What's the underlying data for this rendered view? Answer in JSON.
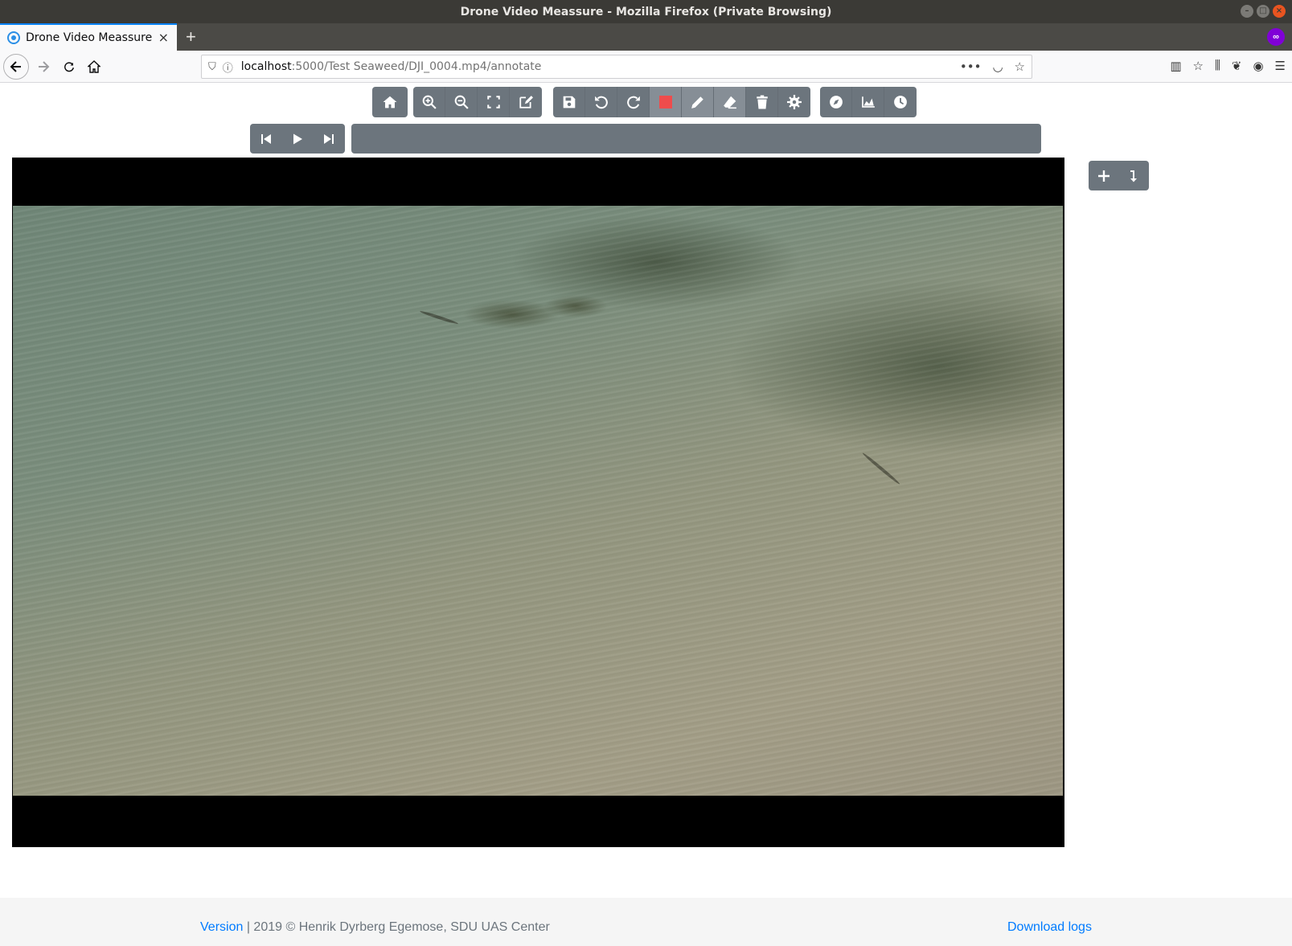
{
  "window": {
    "title": "Drone Video Meassure - Mozilla Firefox (Private Browsing)",
    "controls": [
      "minimize",
      "maximize",
      "close"
    ]
  },
  "browser": {
    "tab_title": "Drone Video Meassure",
    "url_host": "localhost",
    "url_path": ":5000/Test Seaweed/DJI_0004.mp4/annotate"
  },
  "toolbar": {
    "groups": [
      [
        "home-icon"
      ],
      [
        "zoom-in-icon",
        "zoom-out-icon",
        "fit-screen-icon",
        "edit-icon"
      ],
      [
        "save-icon",
        "undo-icon",
        "redo-icon",
        "color-swatch",
        "pencil-icon",
        "eraser-icon",
        "trash-icon",
        "settings-icon"
      ],
      [
        "compass-icon",
        "chart-icon",
        "clock-icon"
      ]
    ],
    "active_tools": [
      "pencil-icon",
      "eraser-icon"
    ],
    "draw_color": "#ef4c4c"
  },
  "player": {
    "buttons": [
      "skip-back-icon",
      "play-icon",
      "skip-forward-icon"
    ],
    "progress": 0
  },
  "side_panel": {
    "buttons": [
      "plus-icon",
      "import-icon"
    ]
  },
  "footer": {
    "version_link": "Version",
    "copyright": " | 2019 © Henrik Dyrberg Egemose, SDU UAS Center",
    "download_link": "Download logs"
  },
  "colors": {
    "button_bg": "#6c757d",
    "link": "#007bff",
    "footer_bg": "#f5f5f5"
  }
}
